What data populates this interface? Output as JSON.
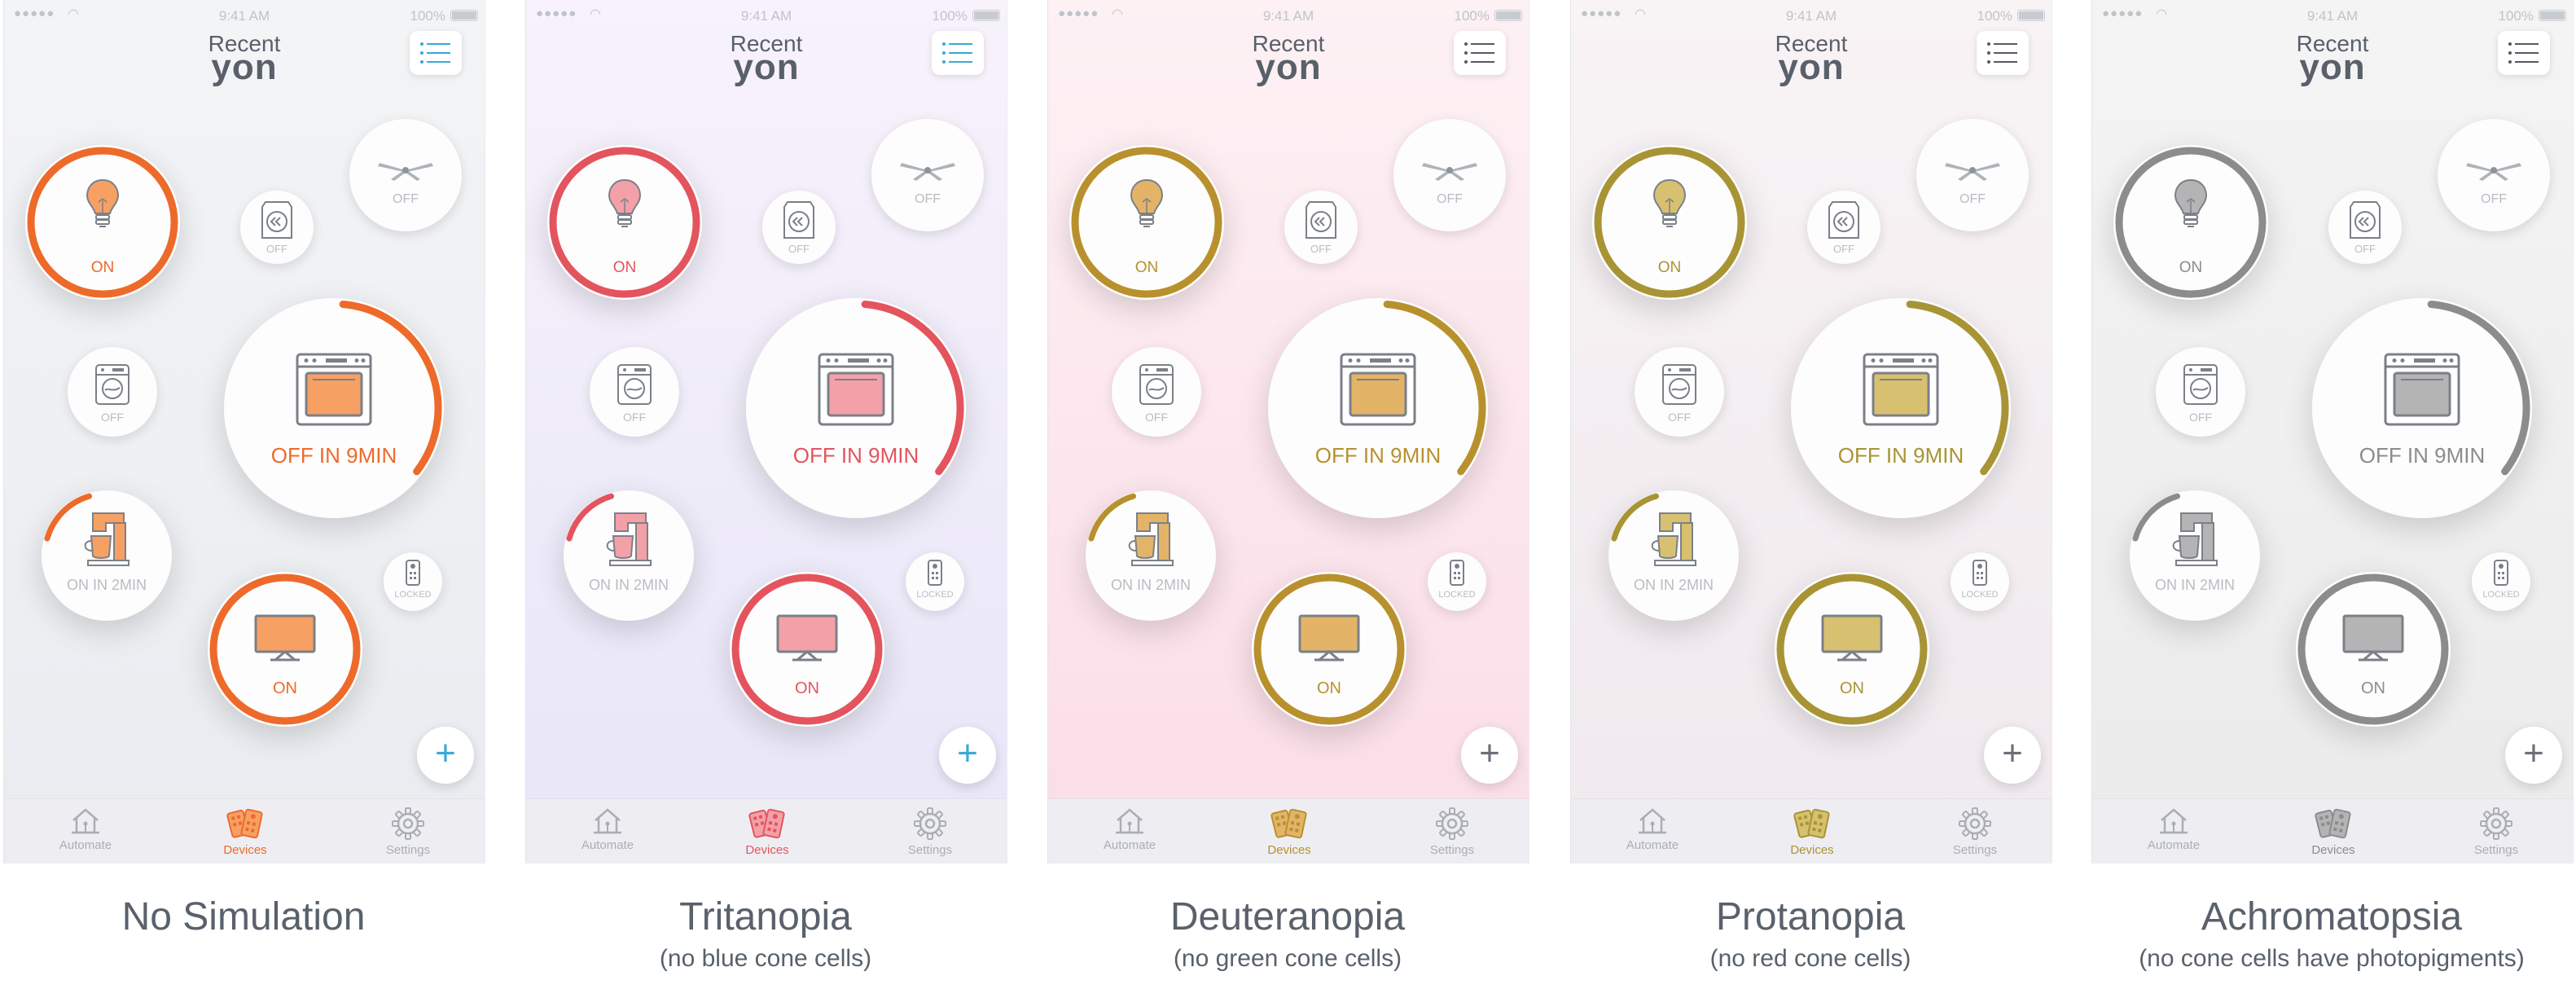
{
  "status_bar": {
    "signal": "●●●●●",
    "time": "9:41 AM",
    "battery": "100%"
  },
  "header": {
    "title_top": "Recent",
    "title_main": "yon"
  },
  "devices": {
    "lamp": "ON",
    "washer": "OFF",
    "fan": "OFF",
    "washer_small": "OFF",
    "oven": "OFF IN 9MIN",
    "coffee": "ON IN 2MIN",
    "tv": "ON",
    "remote": "LOCKED"
  },
  "add_button": "+",
  "tabs": {
    "automate": "Automate",
    "devices": "Devices",
    "settings": "Settings"
  },
  "icons": [
    "wifi-icon",
    "battery-icon",
    "menu-icon",
    "lamp-icon",
    "fan-icon",
    "washer-icon",
    "oven-icon",
    "coffee-maker-icon",
    "tv-icon",
    "remote-icon",
    "home-icon",
    "devices-icon",
    "gear-icon",
    "plus-icon"
  ],
  "panels": [
    {
      "caption": "No Simulation",
      "subcaption": "",
      "accent": "#ee6a2a",
      "fill": "#f7a064",
      "menu_color": "#3aa8d8",
      "bg_top": "#f3f4f6",
      "bg_bottom": "#e9ecf0"
    },
    {
      "caption": "Tritanopia",
      "subcaption": "(no blue cone cells)",
      "accent": "#e4545e",
      "fill": "#f4a0a8",
      "menu_color": "#3aa8d8",
      "bg_top": "#f7f2fb",
      "bg_bottom": "#e8e6f8"
    },
    {
      "caption": "Deuteranopia",
      "subcaption": "(no green cone cells)",
      "accent": "#b8912e",
      "fill": "#e3b468",
      "menu_color": "#555a62",
      "bg_top": "#fdf1f4",
      "bg_bottom": "#fbdde7"
    },
    {
      "caption": "Protanopia",
      "subcaption": "(no red cone cells)",
      "accent": "#a89434",
      "fill": "#d7c170",
      "menu_color": "#555a62",
      "bg_top": "#f8f3f5",
      "bg_bottom": "#f0eaee"
    },
    {
      "caption": "Achromatopsia",
      "subcaption": "(no cone cells have photopigments)",
      "accent": "#8c8c8c",
      "fill": "#b4b4b4",
      "menu_color": "#555a62",
      "bg_top": "#f4f4f4",
      "bg_bottom": "#ebebeb"
    }
  ]
}
